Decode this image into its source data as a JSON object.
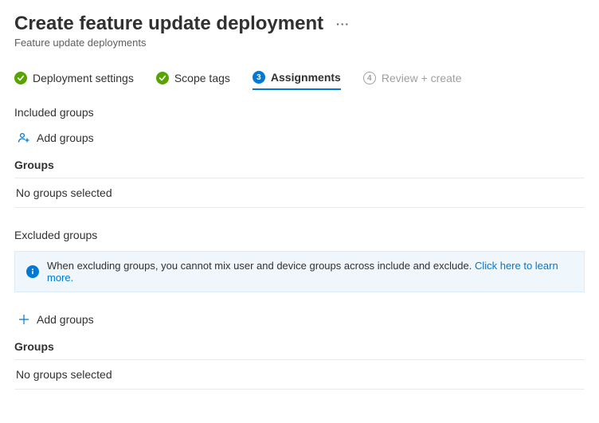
{
  "header": {
    "title": "Create feature update deployment",
    "breadcrumb": "Feature update deployments"
  },
  "tabs": {
    "t1": "Deployment settings",
    "t2": "Scope tags",
    "t3_num": "3",
    "t3": "Assignments",
    "t4_num": "4",
    "t4": "Review + create"
  },
  "included": {
    "heading": "Included groups",
    "add": "Add groups",
    "groups_label": "Groups",
    "empty": "No groups selected"
  },
  "excluded": {
    "heading": "Excluded groups",
    "info_text": "When excluding groups, you cannot mix user and device groups across include and exclude. ",
    "info_link": "Click here to learn more.",
    "add": "Add groups",
    "groups_label": "Groups",
    "empty": "No groups selected"
  }
}
